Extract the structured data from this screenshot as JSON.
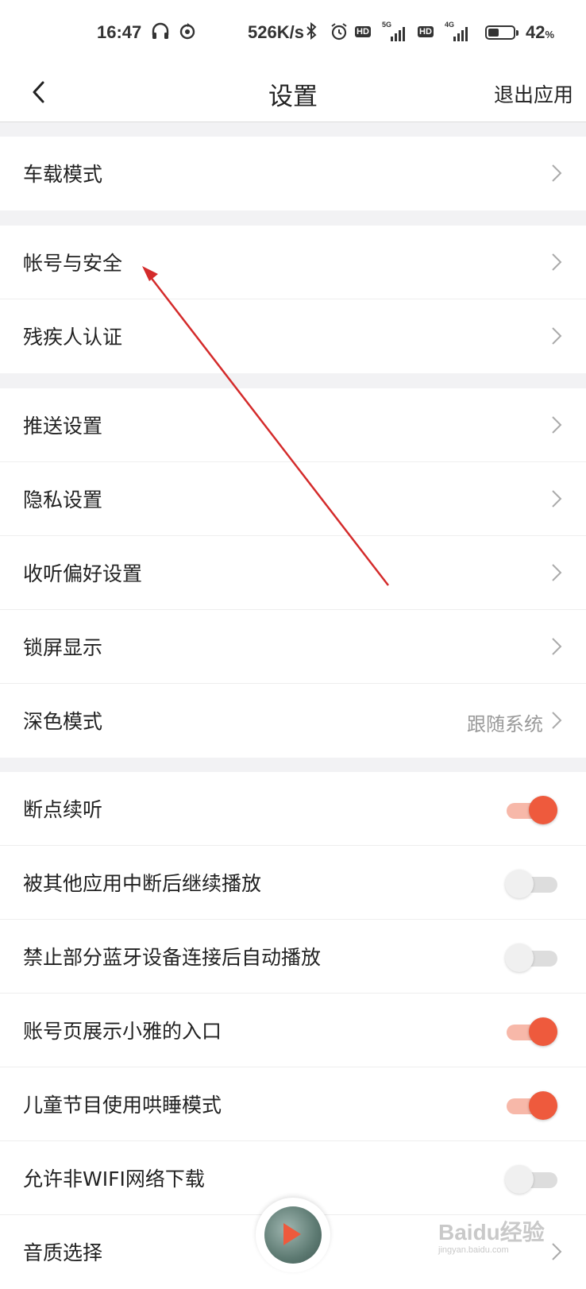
{
  "status_bar": {
    "time": "16:47",
    "speed": "526K/s",
    "hd_badge": "HD",
    "net1": "5G",
    "net2": "4G",
    "battery_level": 0.42,
    "battery_pct": "42",
    "pct_sign": "%"
  },
  "nav": {
    "title": "设置",
    "exit_label": "退出应用"
  },
  "groups": {
    "g1": {
      "car_mode": "车载模式"
    },
    "g2": {
      "account_security": "帐号与安全",
      "disability": "残疾人认证"
    },
    "g3": {
      "push": "推送设置",
      "privacy": "隐私设置",
      "listen_pref": "收听偏好设置",
      "lock_screen": "锁屏显示",
      "dark_mode": "深色模式",
      "dark_mode_value": "跟随系统"
    },
    "g4": {
      "resume": "断点续听",
      "resume_on": true,
      "continue_after_interrupt": "被其他应用中断后继续播放",
      "continue_on": false,
      "bt_autoplay": "禁止部分蓝牙设备连接后自动播放",
      "bt_on": false,
      "xiaoya_entry": "账号页展示小雅的入口",
      "xiaoya_on": true,
      "kids_sleep": "儿童节目使用哄睡模式",
      "kids_on": true,
      "non_wifi": "允许非WIFI网络下载",
      "non_wifi_on": false,
      "quality": "音质选择"
    }
  },
  "watermark": {
    "main": "Baidu经验",
    "sub": "jingyan.baidu.com"
  },
  "colors": {
    "accent": "#ee5a3d",
    "annotation_arrow": "#d42b2b"
  }
}
